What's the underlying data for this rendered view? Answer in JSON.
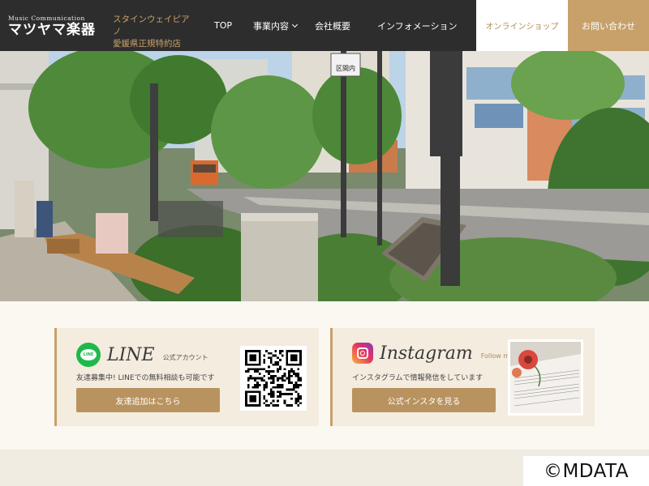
{
  "header": {
    "logo_small": "Music Communication",
    "logo_main": "マツヤマ楽器",
    "dealer_line1": "スタインウェイピアノ",
    "dealer_line2": "愛媛県正規特約店",
    "nav": {
      "top": "TOP",
      "business": "事業内容",
      "company": "会社概要",
      "info": "インフォメーション"
    },
    "shop": "オンラインショップ",
    "contact": "お問い合わせ"
  },
  "hero": {
    "sign_text": "区間内",
    "slides_total": 3,
    "active_slide": 2
  },
  "line_card": {
    "icon_text": "LINE",
    "title": "LINE",
    "subtitle": "公式アカウント",
    "description": "友達募集中! LINEでの無料相談も可能です",
    "button": "友達追加はこちら"
  },
  "instagram_card": {
    "title": "Instagram",
    "subtitle": "Follow me!",
    "description": "インスタグラムで情報発信をしています",
    "button": "公式インスタを見る"
  },
  "watermark": "©MDATA",
  "colors": {
    "header_bg": "#2d2d2d",
    "accent_gold": "#c7a06a",
    "button_gold": "#b9935f",
    "card_bg": "#f3ecdf",
    "line_green": "#1fb94b"
  }
}
